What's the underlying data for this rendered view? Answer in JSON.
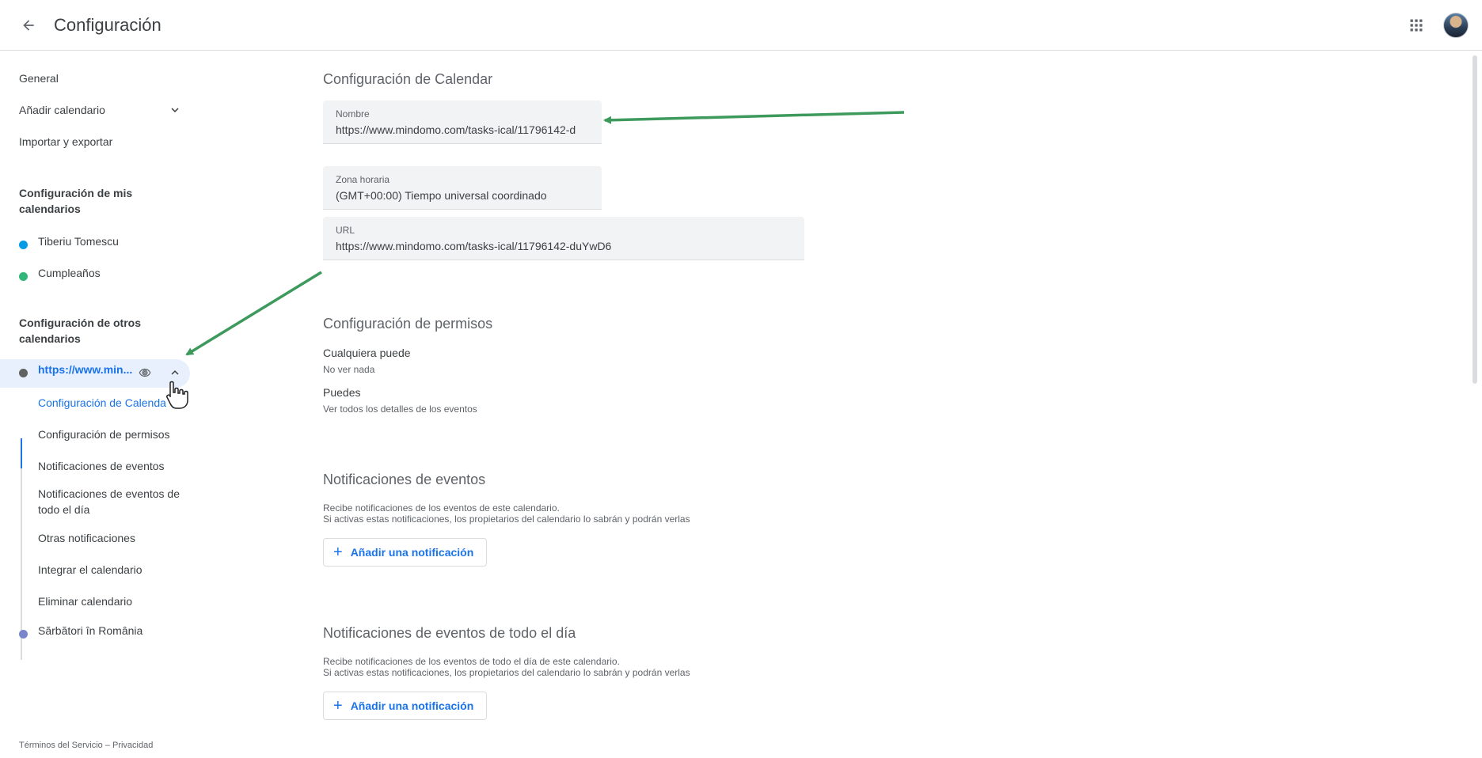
{
  "header": {
    "title": "Configuración",
    "back_icon": "arrow-back-icon",
    "apps_icon": "apps-grid-icon"
  },
  "sidebar": {
    "general": "General",
    "add_calendar": "Añadir calendario",
    "import_export": "Importar y exportar",
    "my_calendars_heading": "Configuración de mis calendarios",
    "my_calendars": [
      {
        "label": "Tiberiu Tomescu",
        "color": "#039be5"
      },
      {
        "label": "Cumpleaños",
        "color": "#33b679"
      }
    ],
    "other_calendars_heading": "Configuración de otros calendarios",
    "active_calendar": {
      "label": "https://www.min...",
      "color": "#616161"
    },
    "sub_items": [
      "Configuración de Calenda",
      "Configuración de permisos",
      "Notificaciones de eventos",
      "Notificaciones de eventos de todo el día",
      "Otras notificaciones",
      "Integrar el calendario",
      "Eliminar calendario"
    ],
    "other_calendar_2": {
      "label": "Sărbători în România",
      "color": "#7986cb"
    },
    "footer": "Términos del Servicio – Privacidad"
  },
  "main": {
    "calendar_settings": {
      "title": "Configuración de Calendar",
      "name_label": "Nombre",
      "name_value": "https://www.mindomo.com/tasks-ical/11796142-d",
      "timezone_label": "Zona horaria",
      "timezone_value": "(GMT+00:00) Tiempo universal coordinado",
      "url_label": "URL",
      "url_value": "https://www.mindomo.com/tasks-ical/11796142-duYwD6"
    },
    "permissions": {
      "title": "Configuración de permisos",
      "anyone_label": "Cualquiera puede",
      "anyone_value": "No ver nada",
      "you_label": "Puedes",
      "you_value": "Ver todos los detalles de los eventos"
    },
    "event_notifications": {
      "title": "Notificaciones de eventos",
      "desc1": "Recibe notificaciones de los eventos de este calendario.",
      "desc2": "Si activas estas notificaciones, los propietarios del calendario lo sabrán y podrán verlas",
      "button": "Añadir una notificación"
    },
    "allday_notifications": {
      "title": "Notificaciones de eventos de todo el día",
      "desc1": "Recibe notificaciones de los eventos de todo el día de este calendario.",
      "desc2": "Si activas estas notificaciones, los propietarios del calendario lo sabrán y podrán verlas",
      "button": "Añadir una notificación"
    }
  },
  "accent_color": "#1a73e8",
  "annotation_color": "#3d9a5c"
}
